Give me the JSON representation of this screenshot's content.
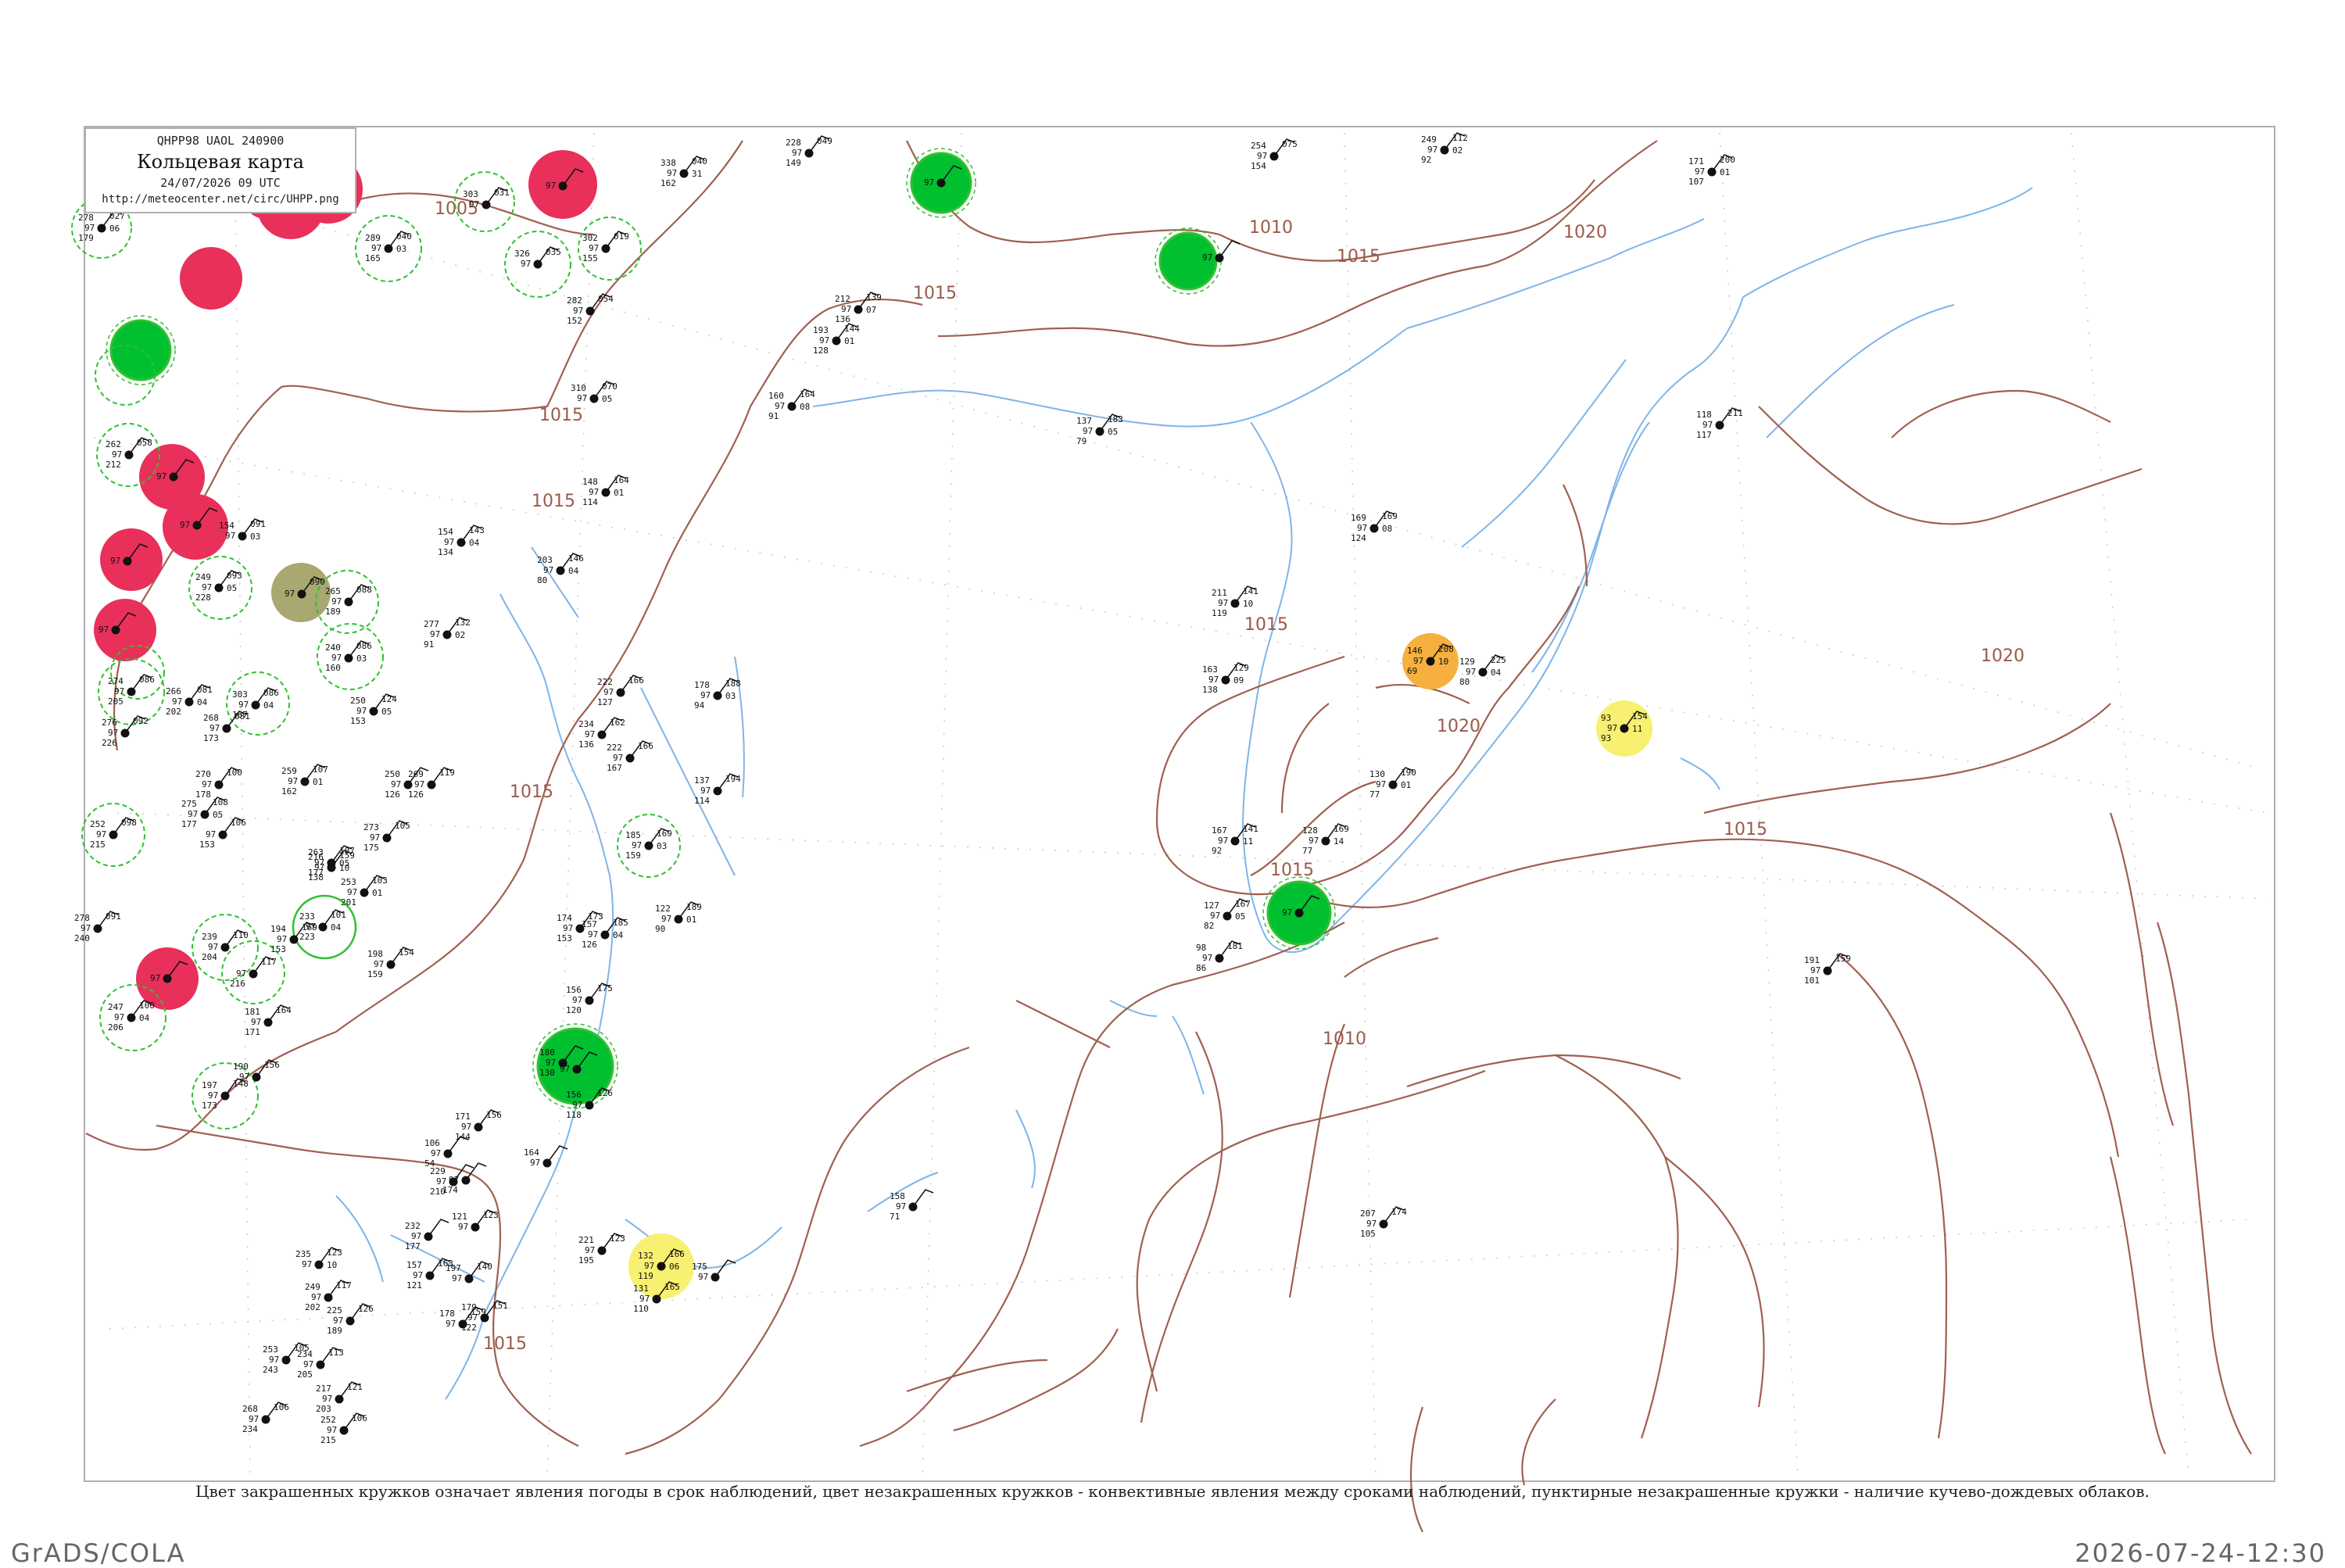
{
  "legend": {
    "code": "QHPP98  UAOL  240900",
    "title": "Кольцевая карта",
    "date": "24/07/2026 09 UTC",
    "url": "http://meteocenter.net/circ/UHPP.png"
  },
  "caption": "Цвет закрашенных кружков означает явления погоды в срок наблюдений, цвет незакрашенных кружков - конвективные явления между сроками наблюдений, пунктирные незакрашенные кружки - наличие кучево-дождевых облаков.",
  "footer": {
    "left": "GrADS/COLA",
    "right": "2026-07-24-12:30"
  },
  "colors": {
    "frame": "#b0b0b0",
    "isobar": "#a06050",
    "river": "#7fb4e8",
    "coast": "#7fb4e8",
    "thunder": "#e8305a",
    "rain": "#00c030",
    "shower_ring": "#30c030",
    "fog": "#f5b040",
    "haze": "#f8f070",
    "dust": "#a8a870"
  },
  "isobars": [
    {
      "label": "1005"
    },
    {
      "label": "1010"
    },
    {
      "label": "1015"
    },
    {
      "label": "1015"
    },
    {
      "label": "1015"
    },
    {
      "label": "1015"
    },
    {
      "label": "1015"
    },
    {
      "label": "1015"
    },
    {
      "label": "1015"
    },
    {
      "label": "1015"
    },
    {
      "label": "1020"
    },
    {
      "label": "1020"
    },
    {
      "label": "1020"
    },
    {
      "label": "1010"
    },
    {
      "label": "1015"
    }
  ],
  "stations": [
    {
      "t": "278",
      "p": "027",
      "d": "179",
      "v": "06",
      "name": "",
      "fill": "",
      "ring": "shower"
    },
    {
      "t": "",
      "p": "",
      "d": "",
      "v": "",
      "name": "",
      "fill": "thunder",
      "ring": "none"
    },
    {
      "t": "303",
      "p": "031",
      "d": "",
      "v": "",
      "name": "",
      "fill": "",
      "ring": "shower"
    },
    {
      "t": "",
      "p": "",
      "d": "",
      "v": "",
      "name": "",
      "fill": "thunder",
      "ring": "none"
    },
    {
      "t": "302",
      "p": "019",
      "d": "155",
      "v": "",
      "name": "",
      "fill": "",
      "ring": "shower"
    },
    {
      "t": "289",
      "p": "040",
      "d": "165",
      "v": "03",
      "name": "",
      "fill": "",
      "ring": "shower"
    },
    {
      "t": "326",
      "p": "035",
      "d": "",
      "v": "",
      "name": "",
      "fill": "",
      "ring": "shower"
    },
    {
      "t": "",
      "p": "",
      "d": "",
      "v": "",
      "name": "",
      "fill": "thunder",
      "ring": "none"
    },
    {
      "t": "",
      "p": "",
      "d": "",
      "v": "",
      "name": "",
      "fill": "rain",
      "ring": "none"
    },
    {
      "t": "262",
      "p": "058",
      "d": "212",
      "v": "",
      "name": "",
      "fill": "",
      "ring": "shower"
    },
    {
      "t": "",
      "p": "",
      "d": "",
      "v": "",
      "name": "",
      "fill": "thunder",
      "ring": "none"
    },
    {
      "t": "",
      "p": "",
      "d": "",
      "v": "",
      "name": "",
      "fill": "thunder",
      "ring": "none"
    },
    {
      "t": "",
      "p": "",
      "d": "",
      "v": "",
      "name": "",
      "fill": "thunder",
      "ring": "none"
    },
    {
      "t": "",
      "p": "",
      "d": "",
      "v": "",
      "name": "",
      "fill": "thunder",
      "ring": "none"
    },
    {
      "t": "249",
      "p": "093",
      "d": "228",
      "v": "05",
      "name": "",
      "fill": "",
      "ring": "shower"
    },
    {
      "t": "",
      "p": "090",
      "d": "",
      "v": "",
      "name": "",
      "fill": "dust",
      "ring": "none"
    },
    {
      "t": "265",
      "p": "088",
      "d": "189",
      "v": "",
      "name": "",
      "fill": "",
      "ring": "shower"
    },
    {
      "t": "240",
      "p": "086",
      "d": "160",
      "v": "03",
      "name": "",
      "fill": "",
      "ring": "shower"
    },
    {
      "t": "274",
      "p": "086",
      "d": "205",
      "v": "",
      "name": "",
      "fill": "",
      "ring": "shower"
    },
    {
      "t": "303",
      "p": "086",
      "d": "167",
      "v": "04",
      "name": "",
      "fill": "",
      "ring": "shower"
    },
    {
      "t": "252",
      "p": "098",
      "d": "215",
      "v": "",
      "name": "",
      "fill": "",
      "ring": "shower"
    },
    {
      "t": "",
      "p": "",
      "d": "",
      "v": "",
      "name": "",
      "fill": "thunder",
      "ring": "none"
    },
    {
      "t": "247",
      "p": "100",
      "d": "206",
      "v": "04",
      "name": "",
      "fill": "",
      "ring": "shower"
    },
    {
      "t": "239",
      "p": "110",
      "d": "204",
      "v": "",
      "name": "",
      "fill": "",
      "ring": "shower"
    },
    {
      "t": "",
      "p": "117",
      "d": "216",
      "v": "",
      "name": "",
      "fill": "",
      "ring": "shower"
    },
    {
      "t": "233",
      "p": "101",
      "d": "223",
      "v": "04",
      "name": "",
      "fill": "",
      "ring": "shower"
    },
    {
      "t": "197",
      "p": "148",
      "d": "173",
      "v": "",
      "name": "",
      "fill": "",
      "ring": "shower"
    },
    {
      "t": "185",
      "p": "169",
      "d": "159",
      "v": "03",
      "name": "",
      "fill": "",
      "ring": "shower"
    },
    {
      "t": "180",
      "p": "",
      "d": "130",
      "v": "",
      "name": "",
      "fill": "rain",
      "ring": "none"
    },
    {
      "t": "",
      "p": "",
      "d": "",
      "v": "",
      "name": "",
      "fill": "rain",
      "ring": "none"
    },
    {
      "t": "",
      "p": "",
      "d": "",
      "v": "",
      "name": "",
      "fill": "rain",
      "ring": "none"
    },
    {
      "t": "",
      "p": "",
      "d": "",
      "v": "",
      "name": "",
      "fill": "rain",
      "ring": "none"
    },
    {
      "t": "146",
      "p": "208",
      "d": "69",
      "v": "10",
      "name": "",
      "fill": "fog",
      "ring": "none"
    },
    {
      "t": "93",
      "p": "154",
      "d": "93",
      "v": "11",
      "name": "",
      "fill": "haze",
      "ring": "none"
    },
    {
      "t": "132",
      "p": "166",
      "d": "119",
      "v": "06",
      "name": "",
      "fill": "haze",
      "ring": "none"
    },
    {
      "t": "228",
      "p": "049",
      "d": "149",
      "v": "",
      "name": "",
      "fill": "",
      "ring": "none"
    },
    {
      "t": "338",
      "p": "040",
      "d": "162",
      "v": "31",
      "name": "",
      "fill": "",
      "ring": "none"
    },
    {
      "t": "254",
      "p": "075",
      "d": "154",
      "v": "",
      "name": "",
      "fill": "",
      "ring": "none"
    },
    {
      "t": "249",
      "p": "112",
      "d": "92",
      "v": "02",
      "name": "",
      "fill": "",
      "ring": "none"
    },
    {
      "t": "171",
      "p": "200",
      "d": "107",
      "v": "01",
      "name": "",
      "fill": "",
      "ring": "none"
    },
    {
      "t": "282",
      "p": "054",
      "d": "152",
      "v": "",
      "name": "",
      "fill": "",
      "ring": "none"
    },
    {
      "t": "212",
      "p": "139",
      "d": "136",
      "v": "07",
      "name": "",
      "fill": "",
      "ring": "none"
    },
    {
      "t": "193",
      "p": "144",
      "d": "128",
      "v": "01",
      "name": "",
      "fill": "",
      "ring": "none"
    },
    {
      "t": "160",
      "p": "164",
      "d": "91",
      "v": "08",
      "name": "",
      "fill": "",
      "ring": "none"
    },
    {
      "t": "310",
      "p": "070",
      "d": "",
      "v": "05",
      "name": "",
      "fill": "",
      "ring": "none"
    },
    {
      "t": "137",
      "p": "183",
      "d": "79",
      "v": "05",
      "name": "",
      "fill": "",
      "ring": "none"
    },
    {
      "t": "118",
      "p": "211",
      "d": "117",
      "v": "",
      "name": "",
      "fill": "",
      "ring": "none"
    },
    {
      "t": "148",
      "p": "164",
      "d": "114",
      "v": "01",
      "name": "",
      "fill": "",
      "ring": "none"
    },
    {
      "t": "154",
      "p": "143",
      "d": "134",
      "v": "04",
      "name": "",
      "fill": "",
      "ring": "none"
    },
    {
      "t": "203",
      "p": "146",
      "d": "80",
      "v": "04",
      "name": "",
      "fill": "",
      "ring": "none"
    },
    {
      "t": "169",
      "p": "169",
      "d": "124",
      "v": "08",
      "name": "",
      "fill": "",
      "ring": "none"
    },
    {
      "t": "211",
      "p": "141",
      "d": "119",
      "v": "10",
      "name": "",
      "fill": "",
      "ring": "none"
    },
    {
      "t": "163",
      "p": "129",
      "d": "138",
      "v": "09",
      "name": "",
      "fill": "",
      "ring": "none"
    },
    {
      "t": "129",
      "p": "225",
      "d": "80",
      "v": "04",
      "name": "",
      "fill": "",
      "ring": "none"
    },
    {
      "t": "130",
      "p": "190",
      "d": "77",
      "v": "01",
      "name": "",
      "fill": "",
      "ring": "none"
    },
    {
      "t": "128",
      "p": "169",
      "d": "77",
      "v": "14",
      "name": "",
      "fill": "",
      "ring": "none"
    },
    {
      "t": "167",
      "p": "141",
      "d": "92",
      "v": "11",
      "name": "",
      "fill": "",
      "ring": "none"
    },
    {
      "t": "127",
      "p": "167",
      "d": "82",
      "v": "05",
      "name": "",
      "fill": "",
      "ring": "none"
    },
    {
      "t": "98",
      "p": "181",
      "d": "86",
      "v": "",
      "name": "",
      "fill": "",
      "ring": "none"
    },
    {
      "t": "191",
      "p": "159",
      "d": "101",
      "v": "",
      "name": "",
      "fill": "",
      "ring": "none"
    },
    {
      "t": "158",
      "p": "",
      "d": "71",
      "v": "",
      "name": "",
      "fill": "",
      "ring": "none"
    },
    {
      "t": "207",
      "p": "174",
      "d": "105",
      "v": "",
      "name": "",
      "fill": "",
      "ring": "none"
    },
    {
      "t": "277",
      "p": "132",
      "d": "91",
      "v": "02",
      "name": "",
      "fill": "",
      "ring": "none"
    },
    {
      "t": "222",
      "p": "166",
      "d": "127",
      "v": "",
      "name": "",
      "fill": "",
      "ring": "none"
    },
    {
      "t": "178",
      "p": "188",
      "d": "94",
      "v": "03",
      "name": "",
      "fill": "",
      "ring": "none"
    },
    {
      "t": "234",
      "p": "162",
      "d": "136",
      "v": "",
      "name": "",
      "fill": "",
      "ring": "none"
    },
    {
      "t": "222",
      "p": "166",
      "d": "167",
      "v": "",
      "name": "",
      "fill": "",
      "ring": "none"
    },
    {
      "t": "137",
      "p": "194",
      "d": "114",
      "v": "",
      "name": "",
      "fill": "",
      "ring": "none"
    },
    {
      "t": "250",
      "p": "124",
      "d": "153",
      "v": "05",
      "name": "",
      "fill": "",
      "ring": "none"
    },
    {
      "t": "266",
      "p": "081",
      "d": "202",
      "v": "04",
      "name": "",
      "fill": "",
      "ring": "none"
    },
    {
      "t": "276",
      "p": "092",
      "d": "226",
      "v": "",
      "name": "",
      "fill": "",
      "ring": "none"
    },
    {
      "t": "268",
      "p": "081",
      "d": "173",
      "v": "",
      "name": "",
      "fill": "",
      "ring": "none"
    },
    {
      "t": "270",
      "p": "100",
      "d": "178",
      "v": "",
      "name": "",
      "fill": "",
      "ring": "none"
    },
    {
      "t": "259",
      "p": "107",
      "d": "162",
      "v": "01",
      "name": "",
      "fill": "",
      "ring": "none"
    },
    {
      "t": "275",
      "p": "108",
      "d": "177",
      "v": "05",
      "name": "",
      "fill": "",
      "ring": "none"
    },
    {
      "t": "",
      "p": "106",
      "d": "153",
      "v": "",
      "name": "",
      "fill": "",
      "ring": "none"
    },
    {
      "t": "273",
      "p": "105",
      "d": "175",
      "v": "",
      "name": "",
      "fill": "",
      "ring": "none"
    },
    {
      "t": "263",
      "p": "107",
      "d": "177",
      "v": "05",
      "name": "",
      "fill": "",
      "ring": "none"
    },
    {
      "t": "253",
      "p": "103",
      "d": "201",
      "v": "01",
      "name": "",
      "fill": "",
      "ring": "none"
    },
    {
      "t": "269",
      "p": "119",
      "d": "126",
      "v": "",
      "name": "",
      "fill": "",
      "ring": "none"
    },
    {
      "t": "250",
      "p": "",
      "d": "126",
      "v": "",
      "name": "",
      "fill": "",
      "ring": "none"
    },
    {
      "t": "216",
      "p": "159",
      "d": "138",
      "v": "10",
      "name": "",
      "fill": "",
      "ring": "none"
    },
    {
      "t": "194",
      "p": "169",
      "d": "153",
      "v": "",
      "name": "",
      "fill": "",
      "ring": "none"
    },
    {
      "t": "174",
      "p": "173",
      "d": "153",
      "v": "",
      "name": "",
      "fill": "",
      "ring": "none"
    },
    {
      "t": "157",
      "p": "185",
      "d": "126",
      "v": "04",
      "name": "",
      "fill": "",
      "ring": "none"
    },
    {
      "t": "122",
      "p": "189",
      "d": "90",
      "v": "01",
      "name": "",
      "fill": "",
      "ring": "none"
    },
    {
      "t": "198",
      "p": "154",
      "d": "159",
      "v": "",
      "name": "",
      "fill": "",
      "ring": "none"
    },
    {
      "t": "181",
      "p": "164",
      "d": "171",
      "v": "",
      "name": "",
      "fill": "",
      "ring": "none"
    },
    {
      "t": "156",
      "p": "175",
      "d": "120",
      "v": "",
      "name": "",
      "fill": "",
      "ring": "none"
    },
    {
      "t": "156",
      "p": "126",
      "d": "118",
      "v": "",
      "name": "",
      "fill": "",
      "ring": "none"
    },
    {
      "t": "190",
      "p": "156",
      "d": "",
      "v": "",
      "name": "",
      "fill": "",
      "ring": "none"
    },
    {
      "t": "171",
      "p": "156",
      "d": "144",
      "v": "",
      "name": "",
      "fill": "",
      "ring": "none"
    },
    {
      "t": "106",
      "p": "",
      "d": "54",
      "v": "",
      "name": "",
      "fill": "",
      "ring": "none"
    },
    {
      "t": "164",
      "p": "",
      "d": "",
      "v": "",
      "name": "",
      "fill": "",
      "ring": "none"
    },
    {
      "t": "",
      "p": "",
      "d": "174",
      "v": "",
      "name": "",
      "fill": "",
      "ring": "none"
    },
    {
      "t": "121",
      "p": "123",
      "d": "",
      "v": "",
      "name": "",
      "fill": "",
      "ring": "none"
    },
    {
      "t": "232",
      "p": "",
      "d": "177",
      "v": "",
      "name": "",
      "fill": "",
      "ring": "none"
    },
    {
      "t": "235",
      "p": "123",
      "d": "",
      "v": "10",
      "name": "",
      "fill": "",
      "ring": "none"
    },
    {
      "t": "221",
      "p": "123",
      "d": "195",
      "v": "",
      "name": "",
      "fill": "",
      "ring": "none"
    },
    {
      "t": "157",
      "p": "163",
      "d": "121",
      "v": "",
      "name": "",
      "fill": "",
      "ring": "none"
    },
    {
      "t": "197",
      "p": "140",
      "d": "",
      "v": "",
      "name": "",
      "fill": "",
      "ring": "none"
    },
    {
      "t": "179",
      "p": "151",
      "d": "122",
      "v": "",
      "name": "",
      "fill": "",
      "ring": "none"
    },
    {
      "t": "249",
      "p": "117",
      "d": "202",
      "v": "",
      "name": "",
      "fill": "",
      "ring": "none"
    },
    {
      "t": "225",
      "p": "126",
      "d": "189",
      "v": "",
      "name": "",
      "fill": "",
      "ring": "none"
    },
    {
      "t": "178",
      "p": "159",
      "d": "",
      "v": "",
      "name": "",
      "fill": "",
      "ring": "none"
    },
    {
      "t": "131",
      "p": "165",
      "d": "110",
      "v": "",
      "name": "",
      "fill": "",
      "ring": "none"
    },
    {
      "t": "175",
      "p": "",
      "d": "",
      "v": "",
      "name": "",
      "fill": "",
      "ring": "none"
    },
    {
      "t": "253",
      "p": "105",
      "d": "243",
      "v": "",
      "name": "",
      "fill": "",
      "ring": "none"
    },
    {
      "t": "234",
      "p": "113",
      "d": "205",
      "v": "",
      "name": "",
      "fill": "",
      "ring": "none"
    },
    {
      "t": "217",
      "p": "121",
      "d": "203",
      "v": "",
      "name": "",
      "fill": "",
      "ring": "none"
    },
    {
      "t": "268",
      "p": "106",
      "d": "234",
      "v": "",
      "name": "",
      "fill": "",
      "ring": "none"
    },
    {
      "t": "252",
      "p": "106",
      "d": "215",
      "v": "",
      "name": "",
      "fill": "",
      "ring": "none"
    },
    {
      "t": "278",
      "p": "091",
      "d": "240",
      "v": "",
      "name": "",
      "fill": "",
      "ring": "none"
    },
    {
      "t": "229",
      "p": "",
      "d": "210",
      "v": "",
      "name": "",
      "fill": "",
      "ring": "none"
    },
    {
      "t": "154",
      "p": "091",
      "d": "",
      "v": "03",
      "name": "",
      "fill": "",
      "ring": "none"
    }
  ]
}
